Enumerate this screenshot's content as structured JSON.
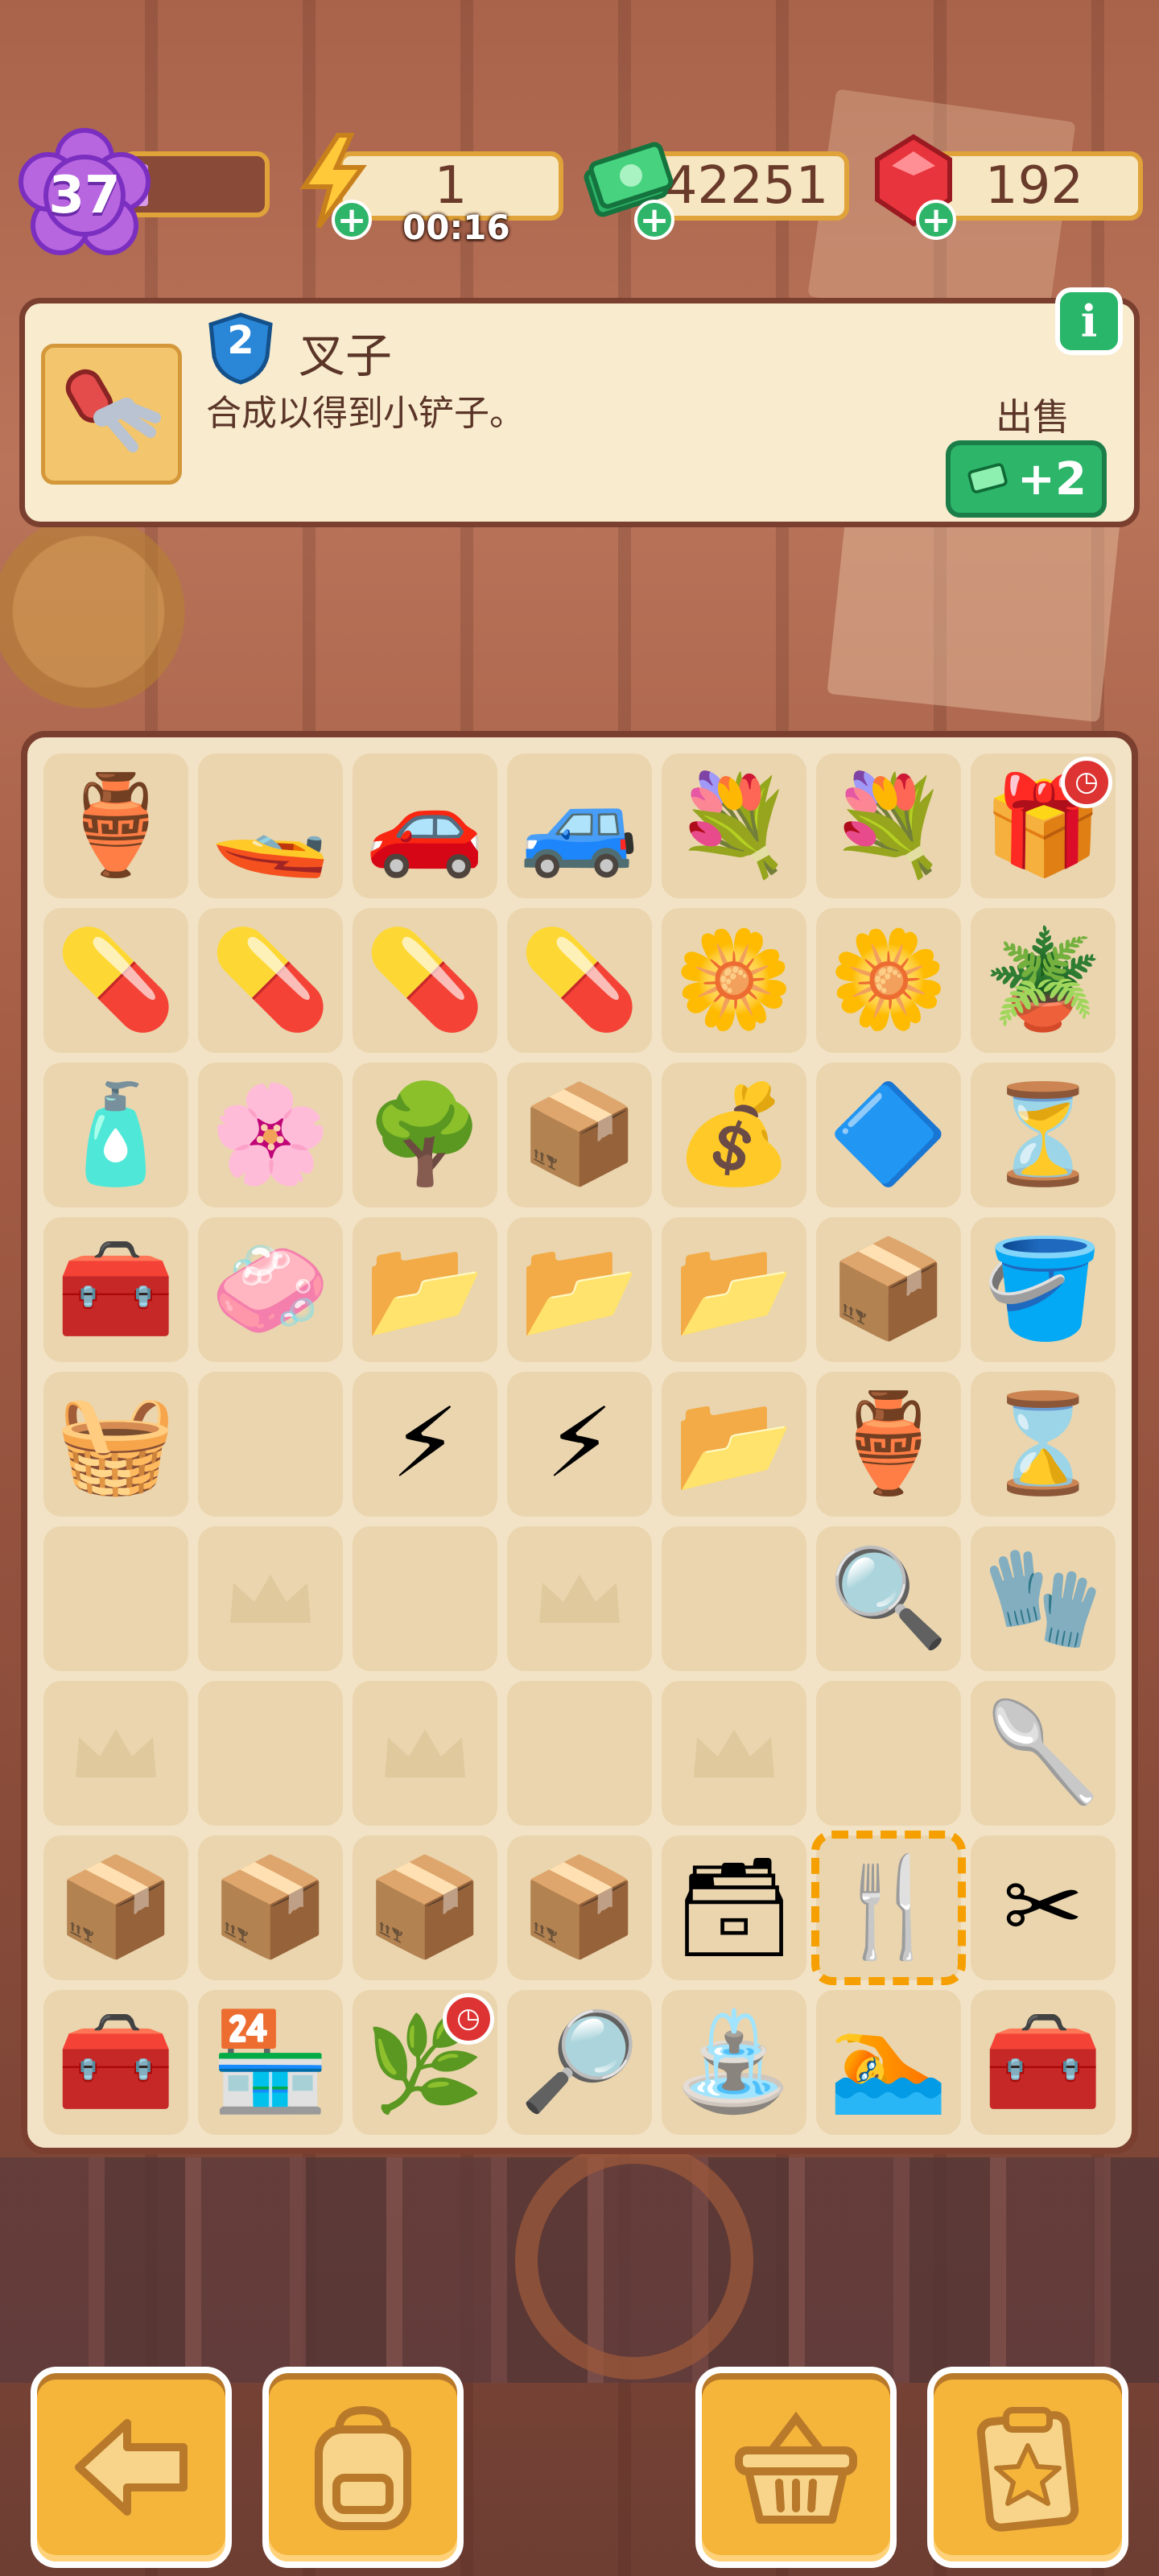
{
  "colors": {
    "accent_orange": "#f5b43a",
    "board_bg": "#f3e3c6",
    "frame_brown": "#7a3f2e",
    "green_button": "#2db56a",
    "purple_level": "#b866e0"
  },
  "hud": {
    "level": "37",
    "energy": "1",
    "energy_timer": "00:16",
    "cash": "42251",
    "gems": "192",
    "level_icon": "purple-flower-badge",
    "energy_icon": "lightning-icon",
    "cash_icon": "cash-stack-icon",
    "gem_icon": "ruby-icon"
  },
  "selected_item": {
    "level": "2",
    "name": "叉子",
    "description": "合成以得到小铲子。",
    "sell_label": "出售",
    "sell_price": "+2",
    "info_label": "i"
  },
  "board": {
    "rows": [
      [
        {
          "name": "dragon-vase",
          "e": "🏺"
        },
        {
          "name": "jet-ski",
          "e": "🚤"
        },
        {
          "name": "purple-car",
          "e": "🚗"
        },
        {
          "name": "jeep",
          "e": "🚙"
        },
        {
          "name": "flower-bouquet",
          "e": "💐"
        },
        {
          "name": "flower-bouquet",
          "e": "💐"
        },
        {
          "name": "gift-box",
          "e": "🎁",
          "badge": "clock"
        }
      ],
      [
        {
          "name": "medicine-kit",
          "e": "💊"
        },
        {
          "name": "medicine-kit",
          "e": "💊"
        },
        {
          "name": "medicine-kit",
          "e": "💊"
        },
        {
          "name": "medicine-kit",
          "e": "💊"
        },
        {
          "name": "flower-pot",
          "e": "🌼"
        },
        {
          "name": "flower-pot",
          "e": "🌼"
        },
        {
          "name": "sprout-pot",
          "e": "🪴"
        }
      ],
      [
        {
          "name": "perfume-bottle",
          "e": "🧴"
        },
        {
          "name": "blossom-tree",
          "e": "🌸"
        },
        {
          "name": "green-tree",
          "e": "🌳"
        },
        {
          "name": "parcel-box",
          "e": "📦"
        },
        {
          "name": "money-bag",
          "e": "💰"
        },
        {
          "name": "crystal-pyramid",
          "e": "🔷"
        },
        {
          "name": "hourglass",
          "e": "⏳"
        }
      ],
      [
        {
          "name": "red-toolbox",
          "e": "🧰"
        },
        {
          "name": "soap-bar",
          "e": "🧼"
        },
        {
          "name": "envelope-file",
          "e": "📂"
        },
        {
          "name": "envelope-file",
          "e": "📂"
        },
        {
          "name": "envelope-file",
          "e": "📂"
        },
        {
          "name": "idea-box",
          "e": "📦"
        },
        {
          "name": "clay-pot",
          "e": "🪣"
        }
      ],
      [
        {
          "name": "red-tray",
          "e": "🧺"
        },
        {
          "name": "empty",
          "e": ""
        },
        {
          "name": "energy-orb",
          "e": "⚡"
        },
        {
          "name": "energy-orb",
          "e": "⚡"
        },
        {
          "name": "envelope-file",
          "e": "📂"
        },
        {
          "name": "broken-pot",
          "e": "🏺"
        },
        {
          "name": "hourglass-gem",
          "e": "⌛"
        }
      ],
      [
        {
          "name": "empty",
          "e": ""
        },
        {
          "name": "empty",
          "e": ""
        },
        {
          "name": "empty",
          "e": ""
        },
        {
          "name": "empty",
          "e": ""
        },
        {
          "name": "empty",
          "e": ""
        },
        {
          "name": "evidence-bag",
          "e": "🔍"
        },
        {
          "name": "glove",
          "e": "🧤"
        }
      ],
      [
        {
          "name": "empty",
          "e": ""
        },
        {
          "name": "empty",
          "e": ""
        },
        {
          "name": "empty",
          "e": ""
        },
        {
          "name": "empty",
          "e": ""
        },
        {
          "name": "empty",
          "e": ""
        },
        {
          "name": "empty",
          "e": ""
        },
        {
          "name": "trowel",
          "e": "🥄"
        }
      ],
      [
        {
          "name": "pottery-crate",
          "e": "📦"
        },
        {
          "name": "pottery-crate",
          "e": "📦"
        },
        {
          "name": "wood-crate",
          "e": "📦"
        },
        {
          "name": "open-box",
          "e": "📦"
        },
        {
          "name": "crime-box",
          "e": "🗃"
        },
        {
          "name": "fork",
          "e": "🍴",
          "selected": true
        },
        {
          "name": "pruning-shears",
          "e": "✂"
        }
      ],
      [
        {
          "name": "toolbox-chest",
          "e": "🧰"
        },
        {
          "name": "vending-station",
          "e": "🏪"
        },
        {
          "name": "garden-scene",
          "e": "🌿",
          "badge": "clock"
        },
        {
          "name": "crime-scene",
          "e": "🔎"
        },
        {
          "name": "fountain",
          "e": "⛲"
        },
        {
          "name": "pool",
          "e": "🏊"
        },
        {
          "name": "toolbox-chest",
          "e": "🧰"
        }
      ]
    ]
  },
  "bottom_bar": {
    "back_icon": "arrow-left-icon",
    "backpack_icon": "backpack-icon",
    "basket_icon": "basket-icon",
    "tasks_icon": "clipboard-star-icon"
  }
}
